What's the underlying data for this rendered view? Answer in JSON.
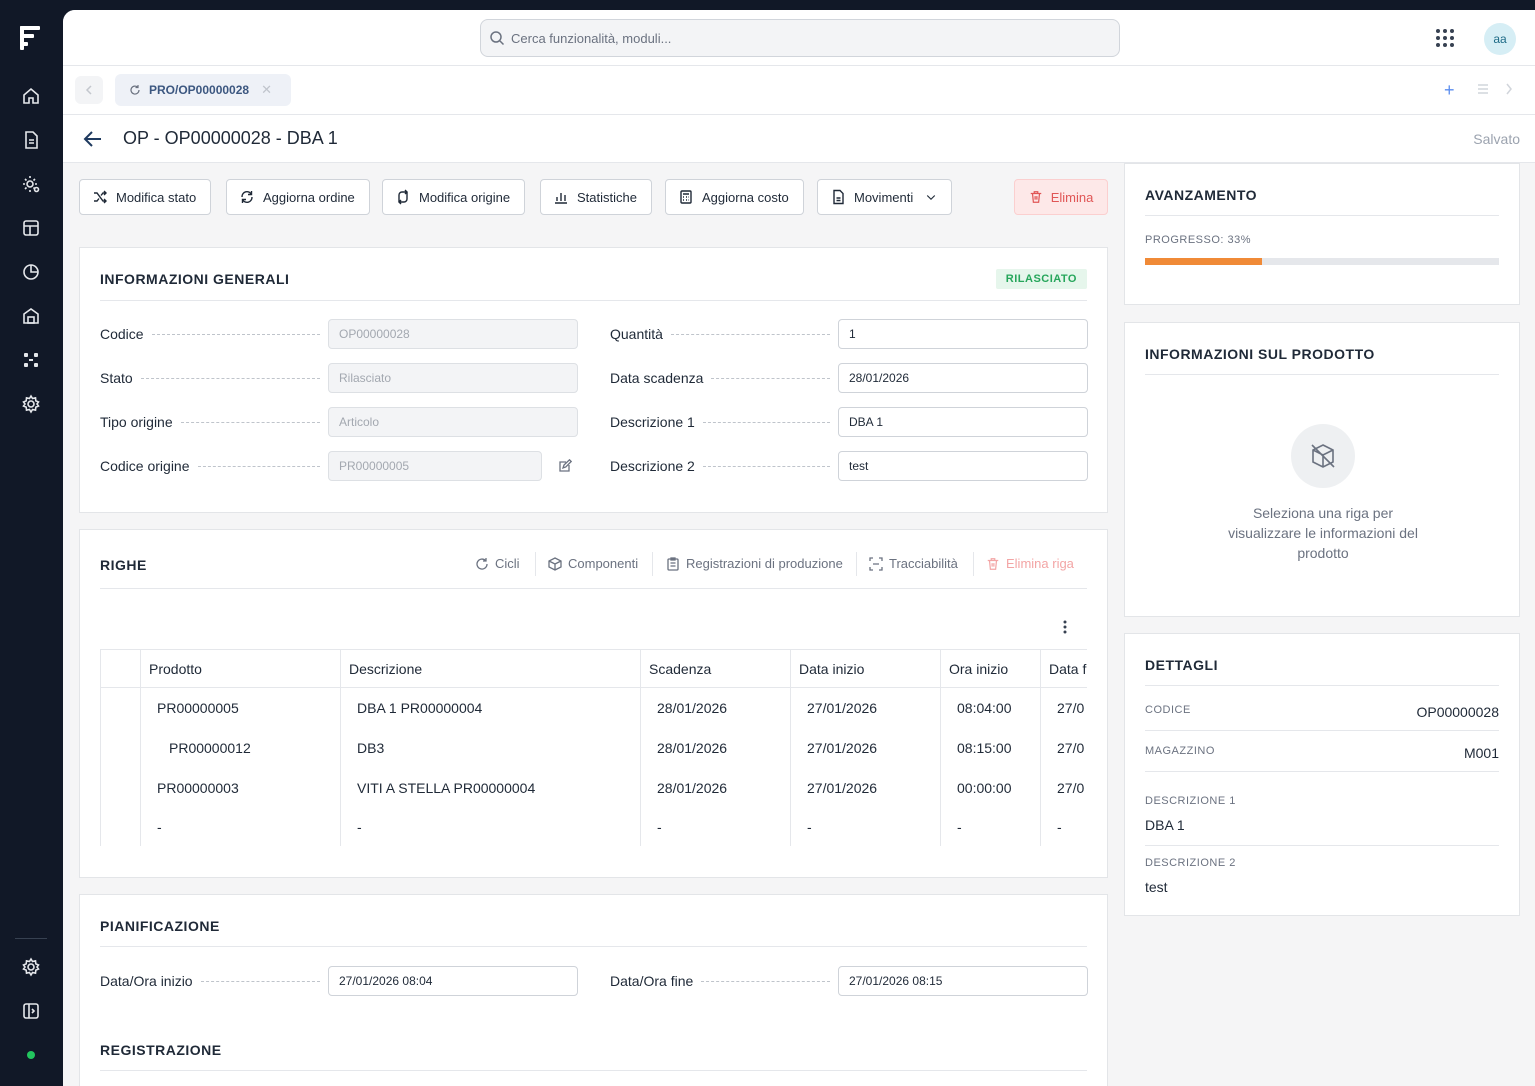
{
  "sidebar": {
    "items": [
      "home-icon",
      "document-icon",
      "settings-cog-icon",
      "table-icon",
      "chart-pie-icon",
      "warehouse-icon",
      "workflow-icon",
      "settings-icon"
    ],
    "bottom": [
      "settings-icon",
      "sidebar-toggle-icon"
    ],
    "status_color": "#22c55e"
  },
  "search": {
    "placeholder": "Cerca funzionalità, moduli..."
  },
  "user": {
    "initials": "aa"
  },
  "tabs": [
    {
      "label": "PRO/OP00000028"
    }
  ],
  "page": {
    "title": "OP - OP00000028 - DBA 1",
    "save_status": "Salvato"
  },
  "toolbar": {
    "modifica_stato": "Modifica stato",
    "aggiorna_ordine": "Aggiorna ordine",
    "modifica_origine": "Modifica origine",
    "statistiche": "Statistiche",
    "aggiorna_costo": "Aggiorna costo",
    "movimenti": "Movimenti",
    "elimina": "Elimina"
  },
  "general": {
    "title": "INFORMAZIONI GENERALI",
    "status_badge": "RILASCIATO",
    "left_fields": [
      {
        "label": "Codice",
        "value": "OP00000028"
      },
      {
        "label": "Stato",
        "value": "Rilasciato"
      },
      {
        "label": "Tipo origine",
        "value": "Articolo"
      },
      {
        "label": "Codice origine",
        "value": "PR00000005"
      }
    ],
    "right_fields": [
      {
        "label": "Quantità",
        "value": "1"
      },
      {
        "label": "Data scadenza",
        "value": "28/01/2026"
      },
      {
        "label": "Descrizione 1",
        "value": "DBA 1"
      },
      {
        "label": "Descrizione 2",
        "value": "test"
      }
    ]
  },
  "righe": {
    "title": "RIGHE",
    "actions": {
      "cicli": "Cicli",
      "componenti": "Componenti",
      "registrazioni": "Registrazioni di produzione",
      "tracciabilita": "Tracciabilità",
      "elimina_riga": "Elimina riga"
    },
    "columns": [
      "Prodotto",
      "Descrizione",
      "Scadenza",
      "Data inizio",
      "Ora inizio",
      "Data f"
    ],
    "rows": [
      [
        "PR00000005",
        "DBA 1 PR00000004",
        "28/01/2026",
        "27/01/2026",
        "08:04:00",
        "27/0"
      ],
      [
        "PR00000012",
        "DB3",
        "28/01/2026",
        "27/01/2026",
        "08:15:00",
        "27/0"
      ],
      [
        "PR00000003",
        "VITI A STELLA PR00000004",
        "28/01/2026",
        "27/01/2026",
        "00:00:00",
        "27/0"
      ],
      [
        "-",
        "-",
        "-",
        "-",
        "-",
        "-"
      ]
    ]
  },
  "pianificazione": {
    "title": "PIANIFICAZIONE",
    "start_label": "Data/Ora inizio",
    "start_value": "27/01/2026 08:04",
    "end_label": "Data/Ora fine",
    "end_value": "27/01/2026 08:15"
  },
  "registrazione": {
    "title": "REGISTRAZIONE"
  },
  "avanzamento": {
    "title": "AVANZAMENTO",
    "progress_label": "PROGRESSO: 33%",
    "progress_fraction": 0.33,
    "progress_color": "#f08a37"
  },
  "prodotto": {
    "title": "INFORMAZIONI SUL PRODOTTO",
    "empty_text": "Seleziona una riga per visualizzare le informazioni del prodotto"
  },
  "dettagli": {
    "title": "DETTAGLI",
    "codice_label": "CODICE",
    "codice_value": "OP00000028",
    "magazzino_label": "MAGAZZINO",
    "magazzino_value": "M001",
    "descrizione1_label": "DESCRIZIONE 1",
    "descrizione1_value": "DBA 1",
    "descrizione2_label": "DESCRIZIONE 2",
    "descrizione2_value": "test"
  }
}
